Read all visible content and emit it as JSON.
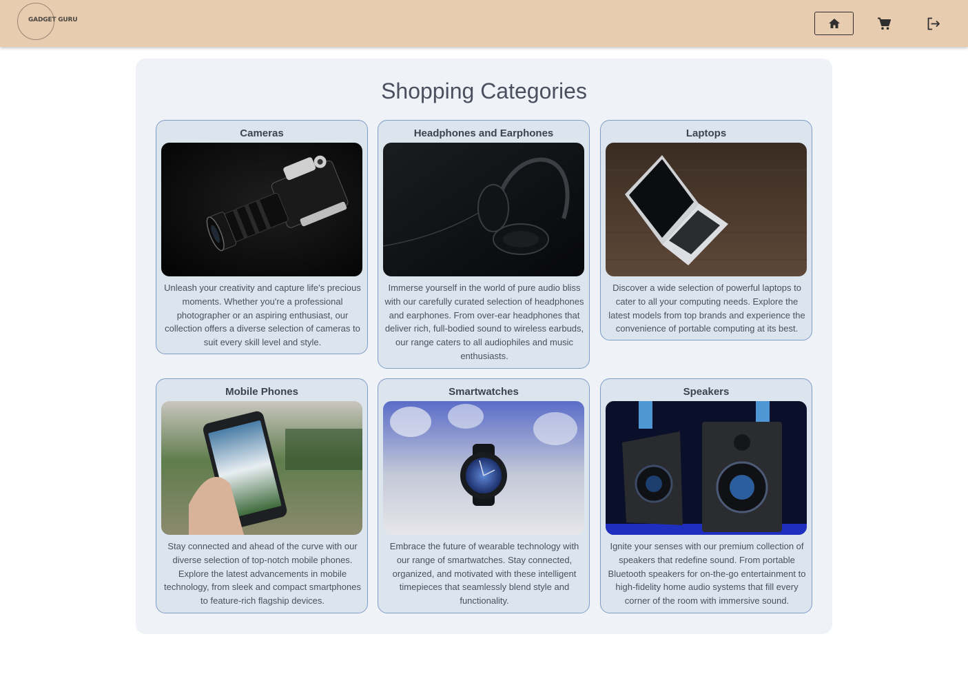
{
  "header": {
    "logo_text": "GADGET GURU",
    "nav": [
      {
        "label": "Home",
        "icon": "home-icon"
      },
      {
        "label": "Cart",
        "icon": "cart-icon"
      },
      {
        "label": "Logout",
        "icon": "logout-icon"
      }
    ]
  },
  "main": {
    "title": "Shopping Categories",
    "categories": [
      {
        "title": "Cameras",
        "description": "Unleash your creativity and capture life's precious moments. Whether you're a professional photographer or an aspiring enthusiast, our collection offers a diverse selection of cameras to suit every skill level and style."
      },
      {
        "title": "Headphones and Earphones",
        "description": "Immerse yourself in the world of pure audio bliss with our carefully curated selection of headphones and earphones. From over-ear headphones that deliver rich, full-bodied sound to wireless earbuds, our range caters to all audiophiles and music enthusiasts."
      },
      {
        "title": "Laptops",
        "description": "Discover a wide selection of powerful laptops to cater to all your computing needs. Explore the latest models from top brands and experience the convenience of portable computing at its best."
      },
      {
        "title": "Mobile Phones",
        "description": "Stay connected and ahead of the curve with our diverse selection of top-notch mobile phones. Explore the latest advancements in mobile technology, from sleek and compact smartphones to feature-rich flagship devices."
      },
      {
        "title": "Smartwatches",
        "description": "Embrace the future of wearable technology with our range of smartwatches. Stay connected, organized, and motivated with these intelligent timepieces that seamlessly blend style and functionality."
      },
      {
        "title": "Speakers",
        "description": "Ignite your senses with our premium collection of speakers that redefine sound. From portable Bluetooth speakers for on-the-go entertainment to high-fidelity home audio systems that fill every corner of the room with immersive sound."
      }
    ]
  },
  "colors": {
    "header_bg": "#e8ccb0",
    "panel_bg": "#eff2f7",
    "card_bg": "#dce4ee",
    "card_border": "#7f9cc8"
  }
}
